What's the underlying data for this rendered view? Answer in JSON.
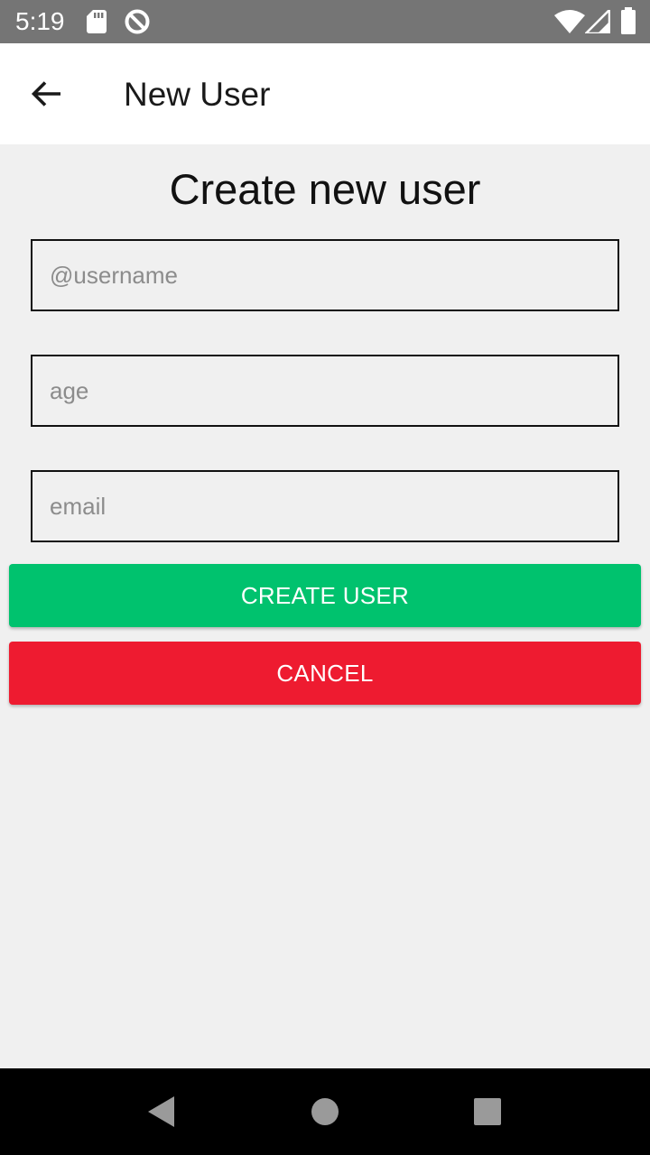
{
  "status_bar": {
    "time": "5:19",
    "icons_left": [
      "sd-card-icon",
      "data-saver-icon"
    ],
    "icons_right": [
      "wifi-icon",
      "cellular-signal-icon",
      "battery-icon"
    ]
  },
  "app_bar": {
    "back_icon": "arrow-left-icon",
    "title": "New User"
  },
  "form": {
    "heading": "Create new user",
    "fields": {
      "username": {
        "placeholder": "@username",
        "value": ""
      },
      "age": {
        "placeholder": "age",
        "value": ""
      },
      "email": {
        "placeholder": "email",
        "value": ""
      }
    },
    "create_label": "CREATE USER",
    "cancel_label": "CANCEL"
  },
  "nav_bar": {
    "back": "nav-back-icon",
    "home": "nav-home-icon",
    "recents": "nav-recents-icon"
  },
  "colors": {
    "status_bar": "#757575",
    "app_bar": "#ffffff",
    "background": "#f0f0f0",
    "create_button": "#00c26e",
    "cancel_button": "#ee1b30",
    "nav_bar": "#000000"
  }
}
